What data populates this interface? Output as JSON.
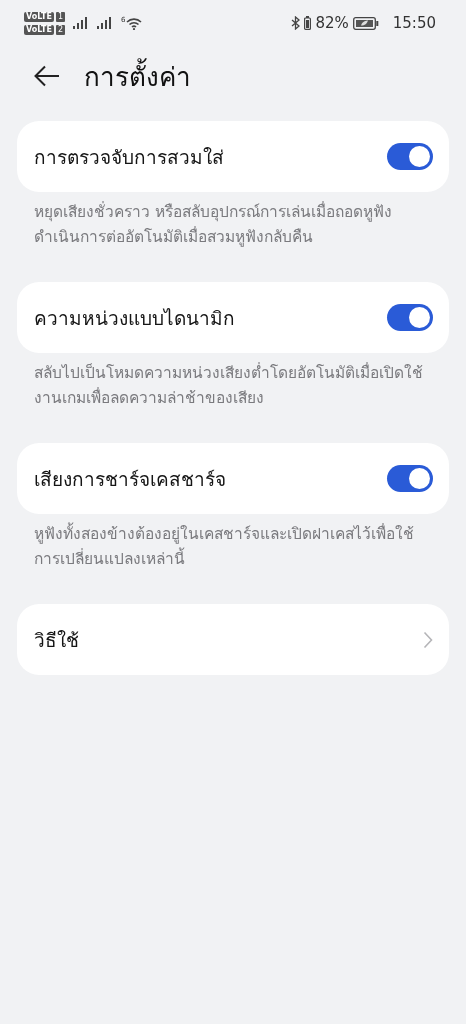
{
  "status_bar": {
    "sims": [
      {
        "badge": "VoLTE",
        "slot": "1"
      },
      {
        "badge": "VoLTE",
        "slot": "2"
      }
    ],
    "wifi_badge": "6",
    "battery_percent": "82%",
    "time": "15:50"
  },
  "header": {
    "title": "การตั้งค่า"
  },
  "settings": [
    {
      "kind": "toggle",
      "label": "การตรวจจับการสวมใส่",
      "on": true,
      "description": "หยุดเสียงชั่วคราว หรือสลับอุปกรณ์การเล่นเมื่อถอดหูฟัง ดำเนินการต่ออัตโนมัติเมื่อสวมหูฟังกลับคืน"
    },
    {
      "kind": "toggle",
      "label": "ความหน่วงแบบไดนามิก",
      "on": true,
      "description": "สลับไปเป็นโหมดความหน่วงเสียงต่ำโดยอัตโนมัติเมื่อเปิดใช้งานเกมเพื่อลดความล่าช้าของเสียง"
    },
    {
      "kind": "toggle",
      "label": "เสียงการชาร์จเคสชาร์จ",
      "on": true,
      "description": "หูฟังทั้งสองข้างต้องอยู่ในเคสชาร์จและเปิดฝาเคสไว้เพื่อใช้การเปลี่ยนแปลงเหล่านี้"
    },
    {
      "kind": "link",
      "label": "วิธีใช้"
    }
  ]
}
